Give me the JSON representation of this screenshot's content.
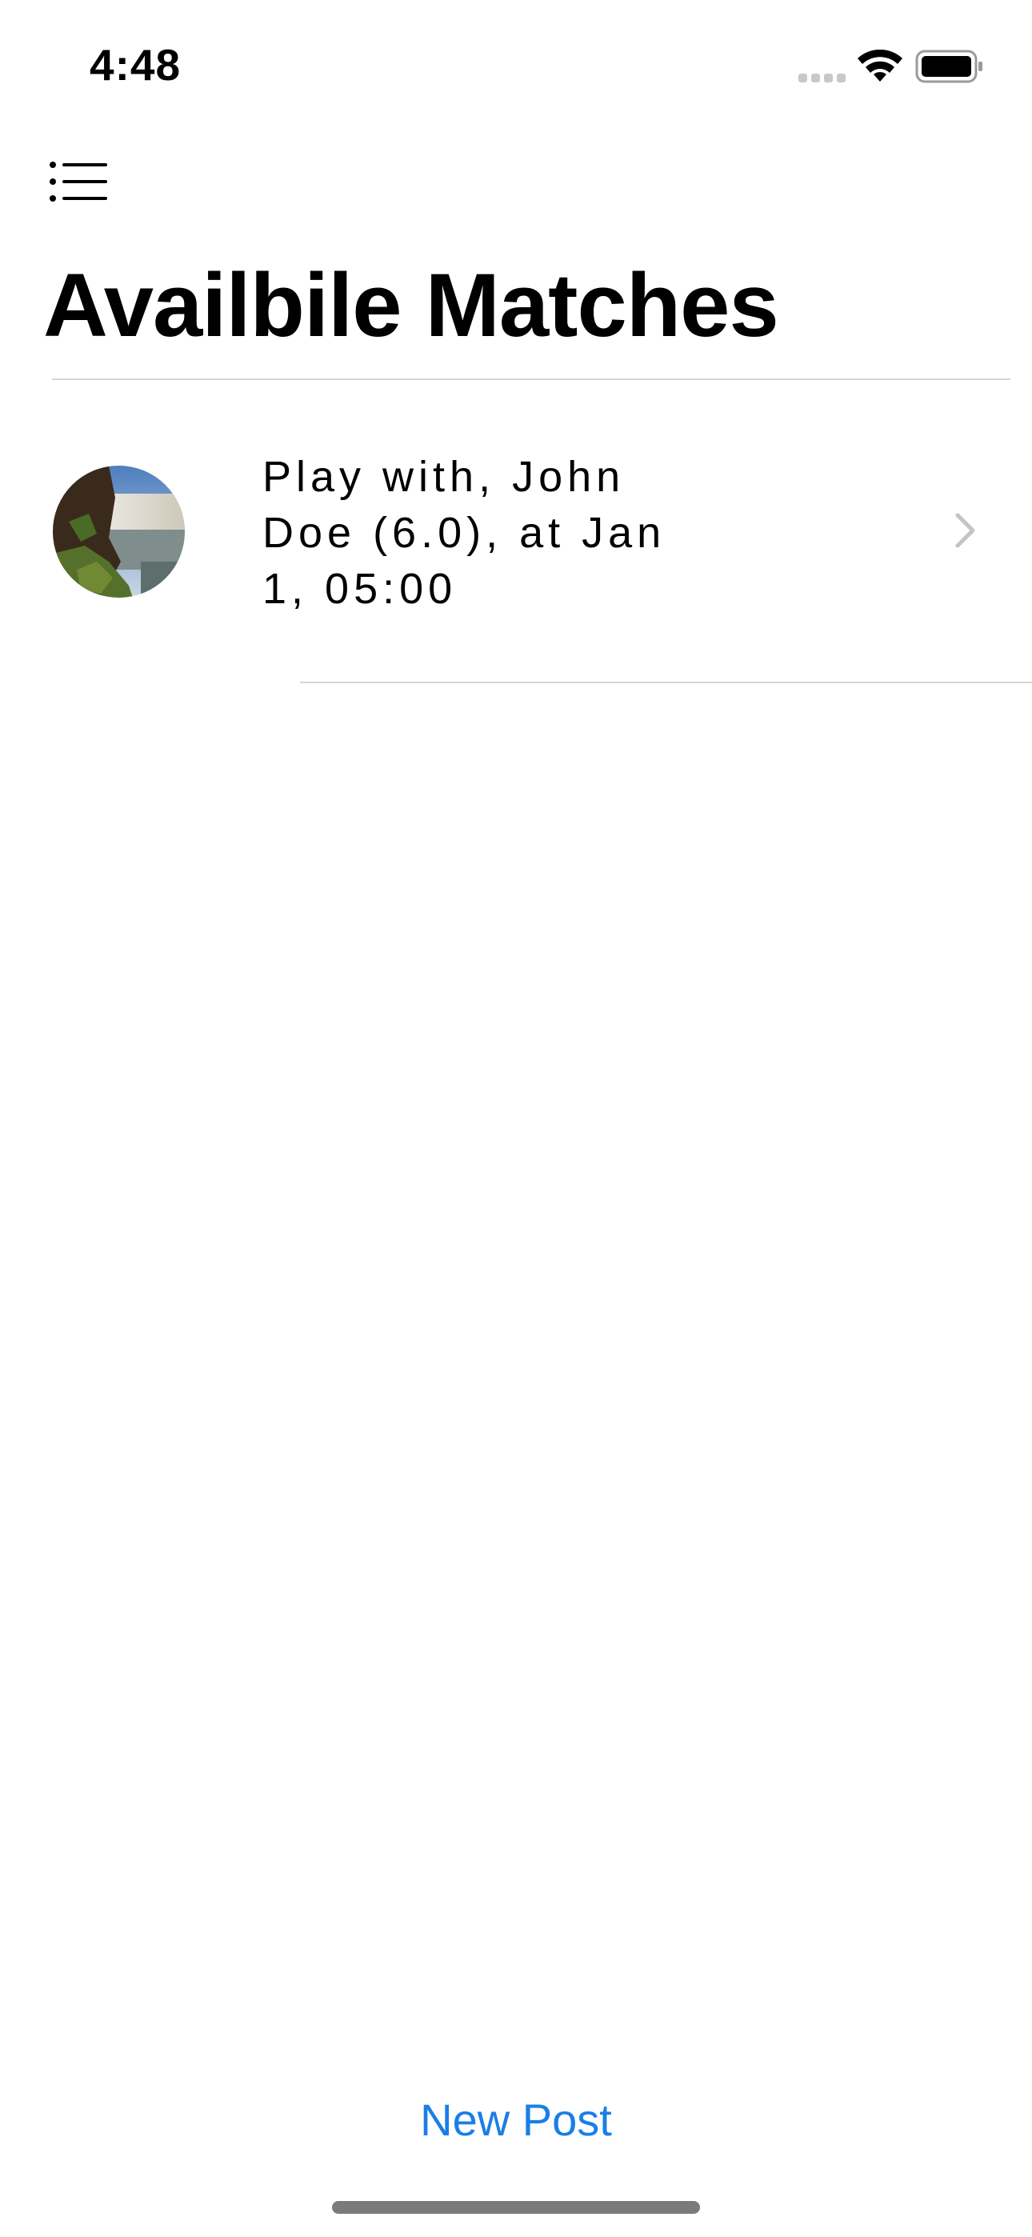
{
  "status_bar": {
    "time": "4:48",
    "icons": [
      "signal-icon",
      "wifi-icon",
      "battery-icon"
    ]
  },
  "nav": {
    "menu_icon": "list-icon",
    "title": "Availbile Matches"
  },
  "matches": [
    {
      "text": "Play with, John Doe (6.0), at Jan 1, 05:00",
      "avatar": "waterfall-photo",
      "accessory_icon": "chevron-right-icon"
    }
  ],
  "footer": {
    "new_post_label": "New Post"
  },
  "colors": {
    "accent": "#1a7ee6",
    "divider": "#d5d5d5",
    "chevron": "#c4c4c7",
    "home_indicator": "#7a7a7a"
  }
}
